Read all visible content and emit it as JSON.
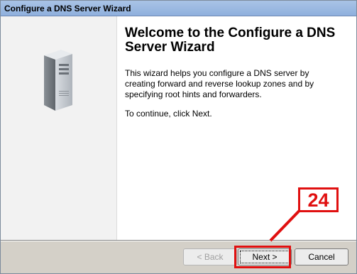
{
  "window": {
    "title": "Configure a DNS Server Wizard"
  },
  "main": {
    "heading": "Welcome to the Configure a DNS Server Wizard",
    "description": "This wizard helps you configure a DNS server by creating forward and reverse lookup zones and by specifying root hints and forwarders.",
    "continue_text": "To continue, click Next."
  },
  "buttons": {
    "back_label": "< Back",
    "next_label": "Next >",
    "cancel_label": "Cancel"
  },
  "annotation": {
    "step_number": "24",
    "color": "#e01010"
  },
  "colors": {
    "titlebar": "#a9c3e6",
    "panel": "#d4d0c8",
    "left_pane": "#f2f2f2"
  }
}
